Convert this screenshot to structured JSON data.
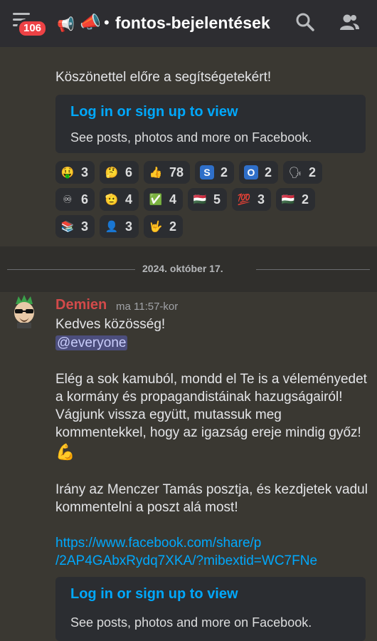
{
  "topbar": {
    "unread_count": "106",
    "channel_icon_1": "📢",
    "channel_icon_2": "📣",
    "channel_dot": "•",
    "channel_name": "fontos-bejelentések",
    "icons": [
      "hamburger-icon",
      "megaphone-icon",
      "search-icon",
      "members-icon"
    ]
  },
  "prev_message": {
    "text": "Köszönettel előre a segítségetekért!",
    "embed": {
      "title": "Log in or sign up to view",
      "description": "See posts, photos and more on Facebook."
    },
    "reactions": [
      {
        "emoji": "🤑",
        "count": "3"
      },
      {
        "emoji": "🤔",
        "count": "6"
      },
      {
        "emoji": "👍",
        "count": "78"
      },
      {
        "emoji": "S",
        "count": "2"
      },
      {
        "emoji": "O",
        "count": "2"
      },
      {
        "emoji": "🗣",
        "count": "2"
      },
      {
        "emoji": "♾",
        "count": "6"
      },
      {
        "emoji": "🫡",
        "count": "4"
      },
      {
        "emoji": "✅",
        "count": "4"
      },
      {
        "emoji": "🇭🇺",
        "count": "5"
      },
      {
        "emoji": "💯",
        "count": "3"
      },
      {
        "emoji": "🇭🇺",
        "count": "2"
      },
      {
        "emoji": "📚",
        "count": "3"
      },
      {
        "emoji": "👤",
        "count": "3"
      },
      {
        "emoji": "🤟",
        "count": "2"
      }
    ]
  },
  "day_separator": "2024. október 17.",
  "message": {
    "author": "Demien",
    "time": "ma 11:57-kor",
    "greeting": "Kedves közösség!",
    "mention": "@everyone",
    "para1_line1": "Elég a sok kamuból, mondd el Te is a véleményedet",
    "para1_line2": "a kormány és propagandistáinak hazugságairól!",
    "para1_line3": "Vágjunk vissza együtt, mutassuk meg",
    "para1_line4": "kommentekkel, hogy az igazság ereje mindig győz!",
    "flex_emoji": "💪",
    "para2_line1": "Irány az Menczer Tamás posztja, és kezdjetek vadul",
    "para2_line2": "kommentelni a poszt alá most!",
    "link_line1": "https://www.facebook.com/share/p",
    "link_line2": "/2AP4GAbxRydq7XKA/?mibextid=WC7FNe",
    "embed": {
      "title": "Log in or sign up to view",
      "description": "See posts, photos and more on Facebook."
    }
  },
  "colors": {
    "background": "#3a3832",
    "topbar": "#2d2d31",
    "embed": "#2b2d31",
    "link": "#00a8fc",
    "author": "#d34a4a",
    "badge": "#ed4245"
  }
}
